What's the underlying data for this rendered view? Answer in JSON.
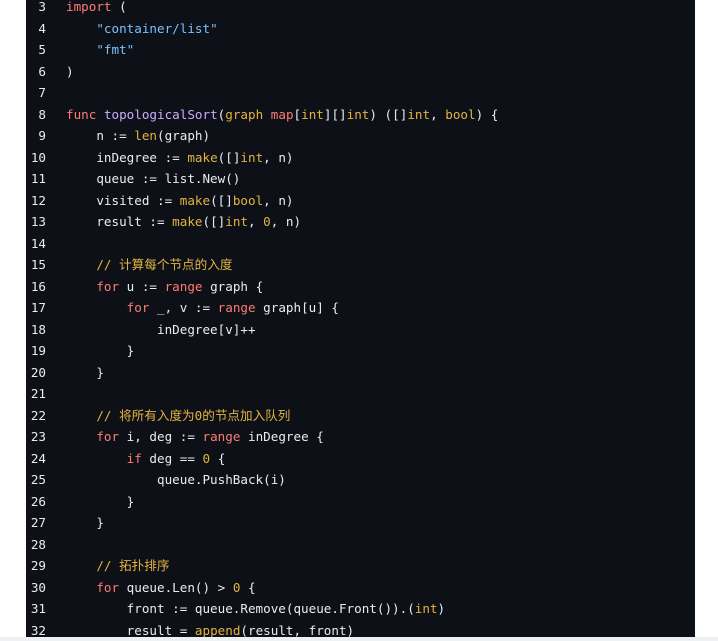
{
  "colors": {
    "background": "#0d1117",
    "keyword": "#ff7b72",
    "function": "#d2a8ff",
    "type": "#e3b341",
    "number": "#e3b341",
    "string": "#79c0ff",
    "comment": "#e3b341",
    "text": "#e6edf3"
  },
  "lines": [
    {
      "n": "3",
      "t": [
        [
          "kw",
          "import"
        ],
        [
          "plain",
          " ("
        ]
      ]
    },
    {
      "n": "4",
      "t": [
        [
          "plain",
          "    "
        ],
        [
          "str",
          "\"container/list\""
        ]
      ]
    },
    {
      "n": "5",
      "t": [
        [
          "plain",
          "    "
        ],
        [
          "str",
          "\"fmt\""
        ]
      ]
    },
    {
      "n": "6",
      "t": [
        [
          "plain",
          ")"
        ]
      ]
    },
    {
      "n": "7",
      "t": []
    },
    {
      "n": "8",
      "t": [
        [
          "kw",
          "func"
        ],
        [
          "plain",
          " "
        ],
        [
          "fn",
          "topologicalSort"
        ],
        [
          "plain",
          "("
        ],
        [
          "ty",
          "graph"
        ],
        [
          "plain",
          " "
        ],
        [
          "kw",
          "map"
        ],
        [
          "plain",
          "["
        ],
        [
          "ty",
          "int"
        ],
        [
          "plain",
          "]"
        ],
        [
          "plain",
          "[]"
        ],
        [
          "ty",
          "int"
        ],
        [
          "plain",
          ") ([]"
        ],
        [
          "ty",
          "int"
        ],
        [
          "plain",
          ", "
        ],
        [
          "ty",
          "bool"
        ],
        [
          "plain",
          ") {"
        ]
      ]
    },
    {
      "n": "9",
      "t": [
        [
          "plain",
          "    n := "
        ],
        [
          "ty",
          "len"
        ],
        [
          "plain",
          "(graph)"
        ]
      ]
    },
    {
      "n": "10",
      "t": [
        [
          "plain",
          "    inDegree := "
        ],
        [
          "ty",
          "make"
        ],
        [
          "plain",
          "([]"
        ],
        [
          "ty",
          "int"
        ],
        [
          "plain",
          ", n)"
        ]
      ]
    },
    {
      "n": "11",
      "t": [
        [
          "plain",
          "    queue := list.New()"
        ]
      ]
    },
    {
      "n": "12",
      "t": [
        [
          "plain",
          "    visited := "
        ],
        [
          "ty",
          "make"
        ],
        [
          "plain",
          "([]"
        ],
        [
          "ty",
          "bool"
        ],
        [
          "plain",
          ", n)"
        ]
      ]
    },
    {
      "n": "13",
      "t": [
        [
          "plain",
          "    result := "
        ],
        [
          "ty",
          "make"
        ],
        [
          "plain",
          "([]"
        ],
        [
          "ty",
          "int"
        ],
        [
          "plain",
          ", "
        ],
        [
          "num",
          "0"
        ],
        [
          "plain",
          ", n)"
        ]
      ]
    },
    {
      "n": "14",
      "t": []
    },
    {
      "n": "15",
      "t": [
        [
          "plain",
          "    "
        ],
        [
          "cm",
          "// 计算每个节点的入度"
        ]
      ]
    },
    {
      "n": "16",
      "t": [
        [
          "plain",
          "    "
        ],
        [
          "kw",
          "for"
        ],
        [
          "plain",
          " u := "
        ],
        [
          "kw",
          "range"
        ],
        [
          "plain",
          " graph {"
        ]
      ]
    },
    {
      "n": "17",
      "t": [
        [
          "plain",
          "        "
        ],
        [
          "kw",
          "for"
        ],
        [
          "plain",
          " _, v := "
        ],
        [
          "kw",
          "range"
        ],
        [
          "plain",
          " graph[u] {"
        ]
      ]
    },
    {
      "n": "18",
      "t": [
        [
          "plain",
          "            inDegree[v]++"
        ]
      ]
    },
    {
      "n": "19",
      "t": [
        [
          "plain",
          "        }"
        ]
      ]
    },
    {
      "n": "20",
      "t": [
        [
          "plain",
          "    }"
        ]
      ]
    },
    {
      "n": "21",
      "t": []
    },
    {
      "n": "22",
      "t": [
        [
          "plain",
          "    "
        ],
        [
          "cm",
          "// 将所有入度为0的节点加入队列"
        ]
      ]
    },
    {
      "n": "23",
      "t": [
        [
          "plain",
          "    "
        ],
        [
          "kw",
          "for"
        ],
        [
          "plain",
          " i, deg := "
        ],
        [
          "kw",
          "range"
        ],
        [
          "plain",
          " inDegree {"
        ]
      ]
    },
    {
      "n": "24",
      "t": [
        [
          "plain",
          "        "
        ],
        [
          "kw",
          "if"
        ],
        [
          "plain",
          " deg == "
        ],
        [
          "num",
          "0"
        ],
        [
          "plain",
          " {"
        ]
      ]
    },
    {
      "n": "25",
      "t": [
        [
          "plain",
          "            queue.PushBack(i)"
        ]
      ]
    },
    {
      "n": "26",
      "t": [
        [
          "plain",
          "        }"
        ]
      ]
    },
    {
      "n": "27",
      "t": [
        [
          "plain",
          "    }"
        ]
      ]
    },
    {
      "n": "28",
      "t": []
    },
    {
      "n": "29",
      "t": [
        [
          "plain",
          "    "
        ],
        [
          "cm",
          "// 拓扑排序"
        ]
      ]
    },
    {
      "n": "30",
      "t": [
        [
          "plain",
          "    "
        ],
        [
          "kw",
          "for"
        ],
        [
          "plain",
          " queue.Len() > "
        ],
        [
          "num",
          "0"
        ],
        [
          "plain",
          " {"
        ]
      ]
    },
    {
      "n": "31",
      "t": [
        [
          "plain",
          "        front := queue.Remove(queue.Front()).("
        ],
        [
          "ty",
          "int"
        ],
        [
          "plain",
          ")"
        ]
      ]
    },
    {
      "n": "32",
      "t": [
        [
          "plain",
          "        result = "
        ],
        [
          "ty",
          "append"
        ],
        [
          "plain",
          "(result, front)"
        ]
      ]
    }
  ]
}
